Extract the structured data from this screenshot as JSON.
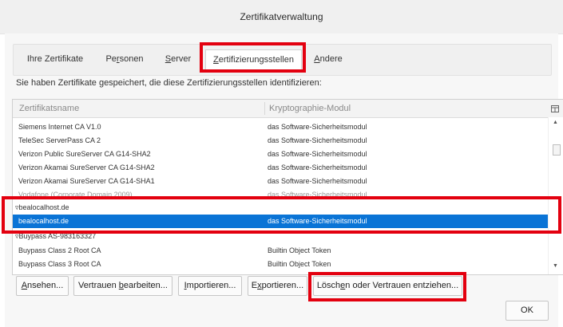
{
  "window": {
    "title": "Zertifikatverwaltung"
  },
  "tabs": [
    {
      "pre": "Ihre Zertifikate",
      "acc": "",
      "post": ""
    },
    {
      "pre": "Pe",
      "acc": "r",
      "post": "sonen"
    },
    {
      "pre": "",
      "acc": "S",
      "post": "erver"
    },
    {
      "pre": "",
      "acc": "Z",
      "post": "ertifizierungsstellen"
    },
    {
      "pre": "",
      "acc": "A",
      "post": "ndere"
    }
  ],
  "intro_text": "Sie haben Zertifikate gespeichert, die diese Zertifizierungsstellen identifizieren:",
  "columns": {
    "name": "Zertifikatsname",
    "module": "Kryptographie-Modul"
  },
  "rows": [
    {
      "name": "Siemens Internet CA V1.0",
      "module": "das Software-Sicherheitsmodul"
    },
    {
      "name": "TeleSec ServerPass CA 2",
      "module": "das Software-Sicherheitsmodul"
    },
    {
      "name": "Verizon Public SureServer CA G14-SHA2",
      "module": "das Software-Sicherheitsmodul"
    },
    {
      "name": "Verizon Akamai SureServer CA G14-SHA2",
      "module": "das Software-Sicherheitsmodul"
    },
    {
      "name": "Verizon Akamai SureServer CA G14-SHA1",
      "module": "das Software-Sicherheitsmodul"
    },
    {
      "name": "Vodafone (Corporate Domain 2009)",
      "module": "das Software-Sicherheitsmodul"
    },
    {
      "name": "▿bealocalhost.de",
      "module": ""
    },
    {
      "name": "bealocalhost.de",
      "module": "das Software-Sicherheitsmodul"
    },
    {
      "name": "▿Buypass AS-983163327",
      "module": ""
    },
    {
      "name": "Buypass Class 2 Root CA",
      "module": "Builtin Object Token"
    },
    {
      "name": "Buypass Class 3 Root CA",
      "module": "Builtin Object Token"
    }
  ],
  "buttons": [
    {
      "pre": "",
      "acc": "A",
      "post": "nsehen..."
    },
    {
      "pre": "Vertrauen ",
      "acc": "b",
      "post": "earbeiten..."
    },
    {
      "pre": "",
      "acc": "I",
      "post": "mportieren..."
    },
    {
      "pre": "E",
      "acc": "x",
      "post": "portieren..."
    },
    {
      "pre": "Lösch",
      "acc": "e",
      "post": "n oder Vertrauen entziehen..."
    }
  ],
  "ok_label": "OK",
  "icons": {
    "column_picker": "column-picker-icon",
    "scroll_up": "chevron-up-icon",
    "scroll_down": "chevron-down-icon"
  },
  "colors": {
    "selection": "#0a74d6",
    "highlight_box": "#e3000f"
  }
}
